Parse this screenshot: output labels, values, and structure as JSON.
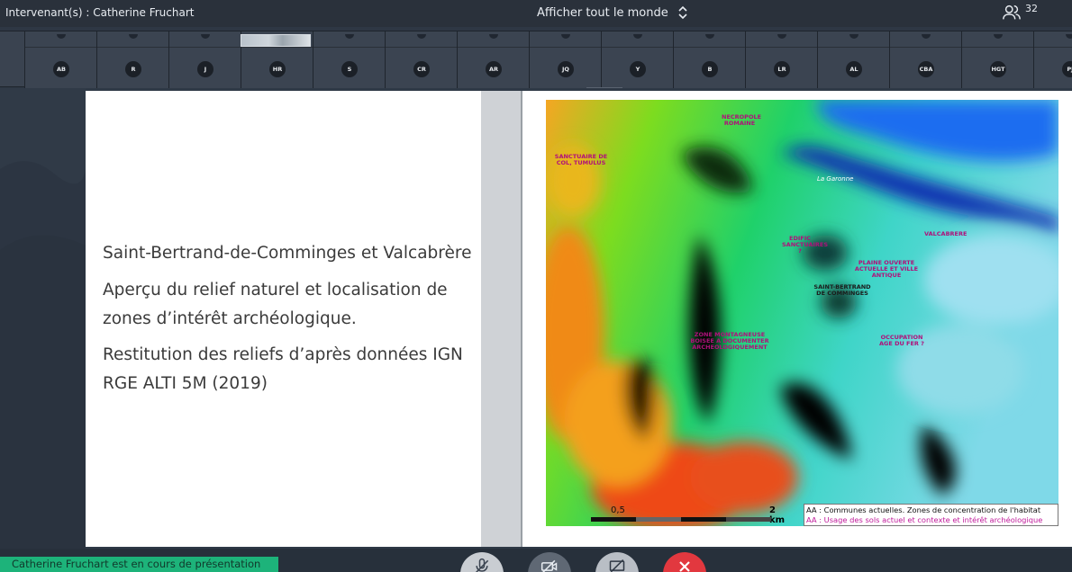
{
  "topbar": {
    "speaker_label": "Intervenant(s) : Catherine Fruchart",
    "view_toggle_label": "Afficher tout le monde",
    "participant_count": "32"
  },
  "strip": {
    "participants": [
      "AB",
      "R",
      "J",
      "HR",
      "S",
      "CR",
      "AR",
      "JQ",
      "Y",
      "B",
      "LR",
      "AL",
      "CBA",
      "HGT",
      "PJ"
    ]
  },
  "slide": {
    "title": "Saint-Bertrand-de-Comminges et Valcabrère",
    "subtitle": "Aperçu du relief naturel et localisation de zones d’intérêt archéologique.",
    "source": "Restitution des reliefs d’après données IGN RGE ALTI 5M (2019)",
    "map": {
      "labels": {
        "necropole": "NECROPOLE ROMAINE",
        "sanctuaire": "SANCTUAIRE DE COL, TUMULUS",
        "garonne": "La Garonne",
        "valcabrere": "VALCABRERE",
        "sanctuaires": "EDIFIC SANCTUAIRES ?",
        "plaine": "PLAINE OUVERTE ACTUELLE ET VILLE ANTIQUE",
        "saint_bertrand": "SAINT-BERTRAND DE COMMINGES",
        "zone": "ZONE MONTAGNEUSE BOISEE A DOCUMENTER ARCHEOLOGIQUEMENT",
        "occupation": "OCCUPATION AGE DU FER ?"
      },
      "scale_mid": "0,5",
      "scale_end": "2 km",
      "legend_line1": "AA : Communes actuelles. Zones de concentration de l'habitat",
      "legend_line2": "AA : Usage des sols actuel et contexte et intérêt archéologique"
    }
  },
  "bottombar": {
    "status": "Catherine Fruchart est en cours de présentation"
  },
  "colors": {
    "status_green": "#1db37a",
    "end_call_red": "#e2383f"
  }
}
